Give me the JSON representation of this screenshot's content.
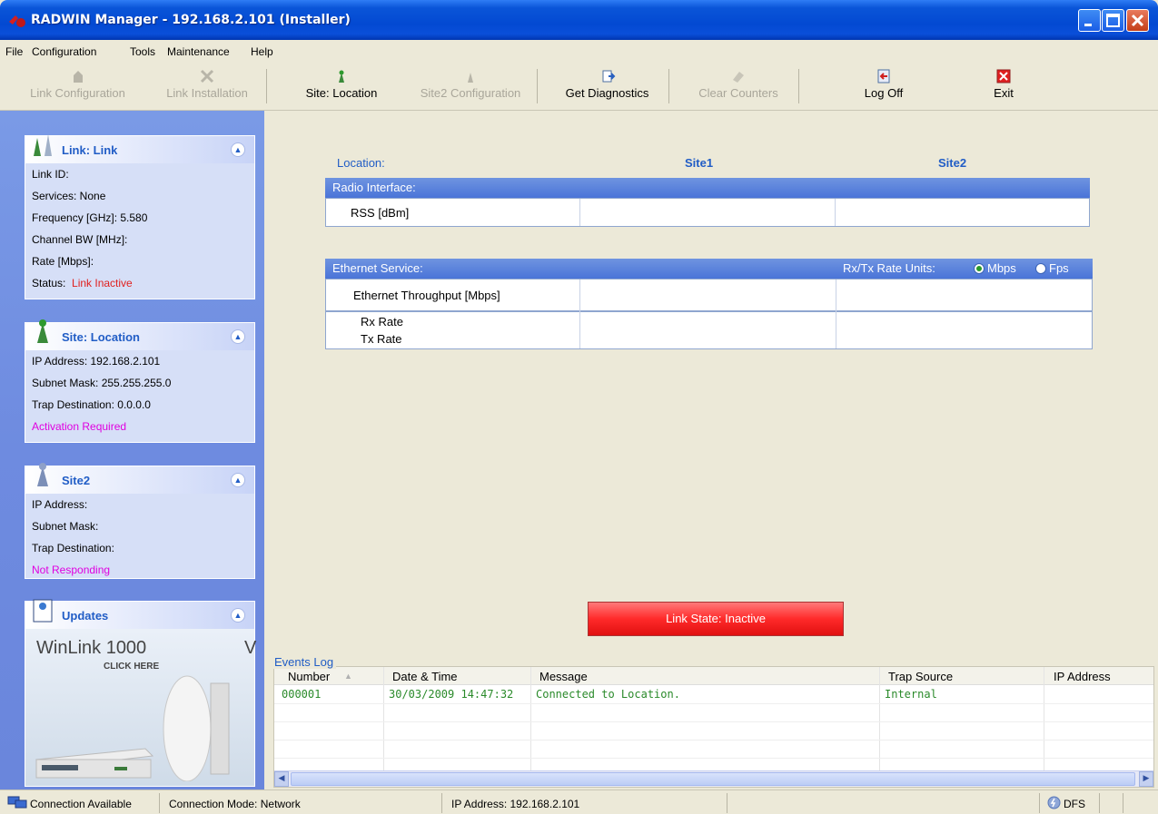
{
  "window": {
    "title": "RADWIN Manager - 192.168.2.101 (Installer)"
  },
  "menu": [
    "File",
    "Configuration",
    "Tools",
    "Maintenance",
    "Help"
  ],
  "toolbar": {
    "link_configuration": "Link Configuration",
    "link_installation": "Link Installation",
    "site_location": "Site: Location",
    "site2_configuration": "Site2 Configuration",
    "get_diagnostics": "Get Diagnostics",
    "clear_counters": "Clear Counters",
    "log_off": "Log Off",
    "exit": "Exit"
  },
  "sidebar": {
    "link": {
      "title": "Link: Link",
      "rows": [
        "Link ID:",
        "Services:  None",
        "Frequency [GHz]:  5.580",
        "Channel BW [MHz]:",
        "Rate [Mbps]:"
      ],
      "status_label": "Status:",
      "status_value": "Link Inactive"
    },
    "site_location": {
      "title": "Site: Location",
      "rows": [
        "IP Address:  192.168.2.101",
        "Subnet Mask:  255.255.255.0",
        "Trap Destination:  0.0.0.0"
      ],
      "note": "Activation Required"
    },
    "site2": {
      "title": "Site2",
      "rows": [
        "IP Address:",
        "Subnet Mask:",
        "Trap Destination:"
      ],
      "note": "Not Responding"
    },
    "updates": {
      "title": "Updates",
      "banner_title": "WinLink 1000",
      "banner_cta": "CLICK HERE",
      "banner_fragment": "V"
    }
  },
  "main": {
    "location_label": "Location:",
    "site1_label": "Site1",
    "site2_label": "Site2",
    "radio_header": "Radio Interface:",
    "rss_label": "RSS [dBm]",
    "ethernet_header": "Ethernet Service:",
    "rate_units_label": "Rx/Tx Rate Units:",
    "mbps_label": "Mbps",
    "fps_label": "Fps",
    "throughput_label": "Ethernet Throughput [Mbps]",
    "rx_label": "Rx Rate",
    "tx_label": "Tx Rate",
    "link_state": "Link State: Inactive"
  },
  "events": {
    "legend": "Events Log",
    "columns": [
      "Number",
      "Date & Time",
      "Message",
      "Trap Source",
      "IP Address"
    ],
    "rows": [
      {
        "number": "000001",
        "datetime": "30/03/2009 14:47:32",
        "message": "Connected to Location.",
        "trap_source": "Internal",
        "ip": ""
      }
    ]
  },
  "status": {
    "connection": "Connection Available",
    "mode": "Connection Mode: Network",
    "ip": "IP Address: 192.168.2.101",
    "dfs": "DFS"
  },
  "colors": {
    "accent": "#215dc6",
    "status_red": "#e0201e",
    "note_magenta": "#e000e0",
    "event_green": "#2a8a2a"
  }
}
